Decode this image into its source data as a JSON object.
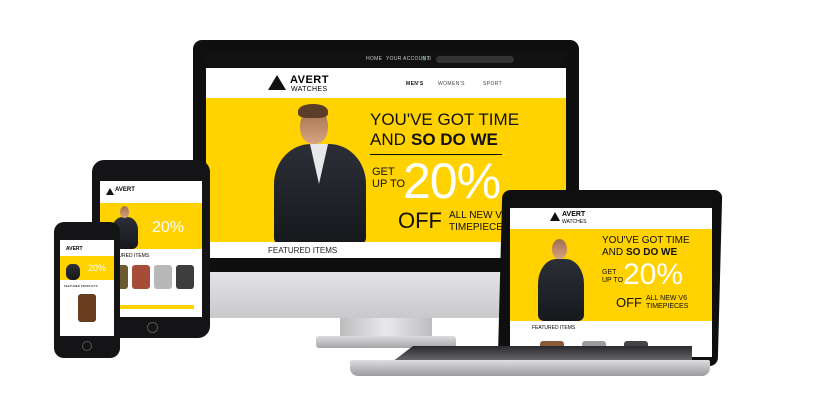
{
  "brand": {
    "name": "AVERT",
    "sub": "WATCHES"
  },
  "topbar": {
    "home": "HOME",
    "account": "YOUR ACCOUNT",
    "cart": "0"
  },
  "nav": {
    "men": "MEN'S",
    "women": "WOMEN'S",
    "sport": "SPORT"
  },
  "hero": {
    "line1": "YOU'VE GOT TIME",
    "line2a": "AND ",
    "line2b": "SO DO WE",
    "get": "GET",
    "upto": "UP TO",
    "percent": "20%",
    "off": "OFF",
    "allnew": "ALL NEW V6",
    "timepieces": "TIMEPIECES"
  },
  "featured": "FEATURED ITEMS",
  "featured_products": "FEATURED PRODUCTS",
  "colors": {
    "accent": "#ffd200",
    "dark": "#111111"
  }
}
